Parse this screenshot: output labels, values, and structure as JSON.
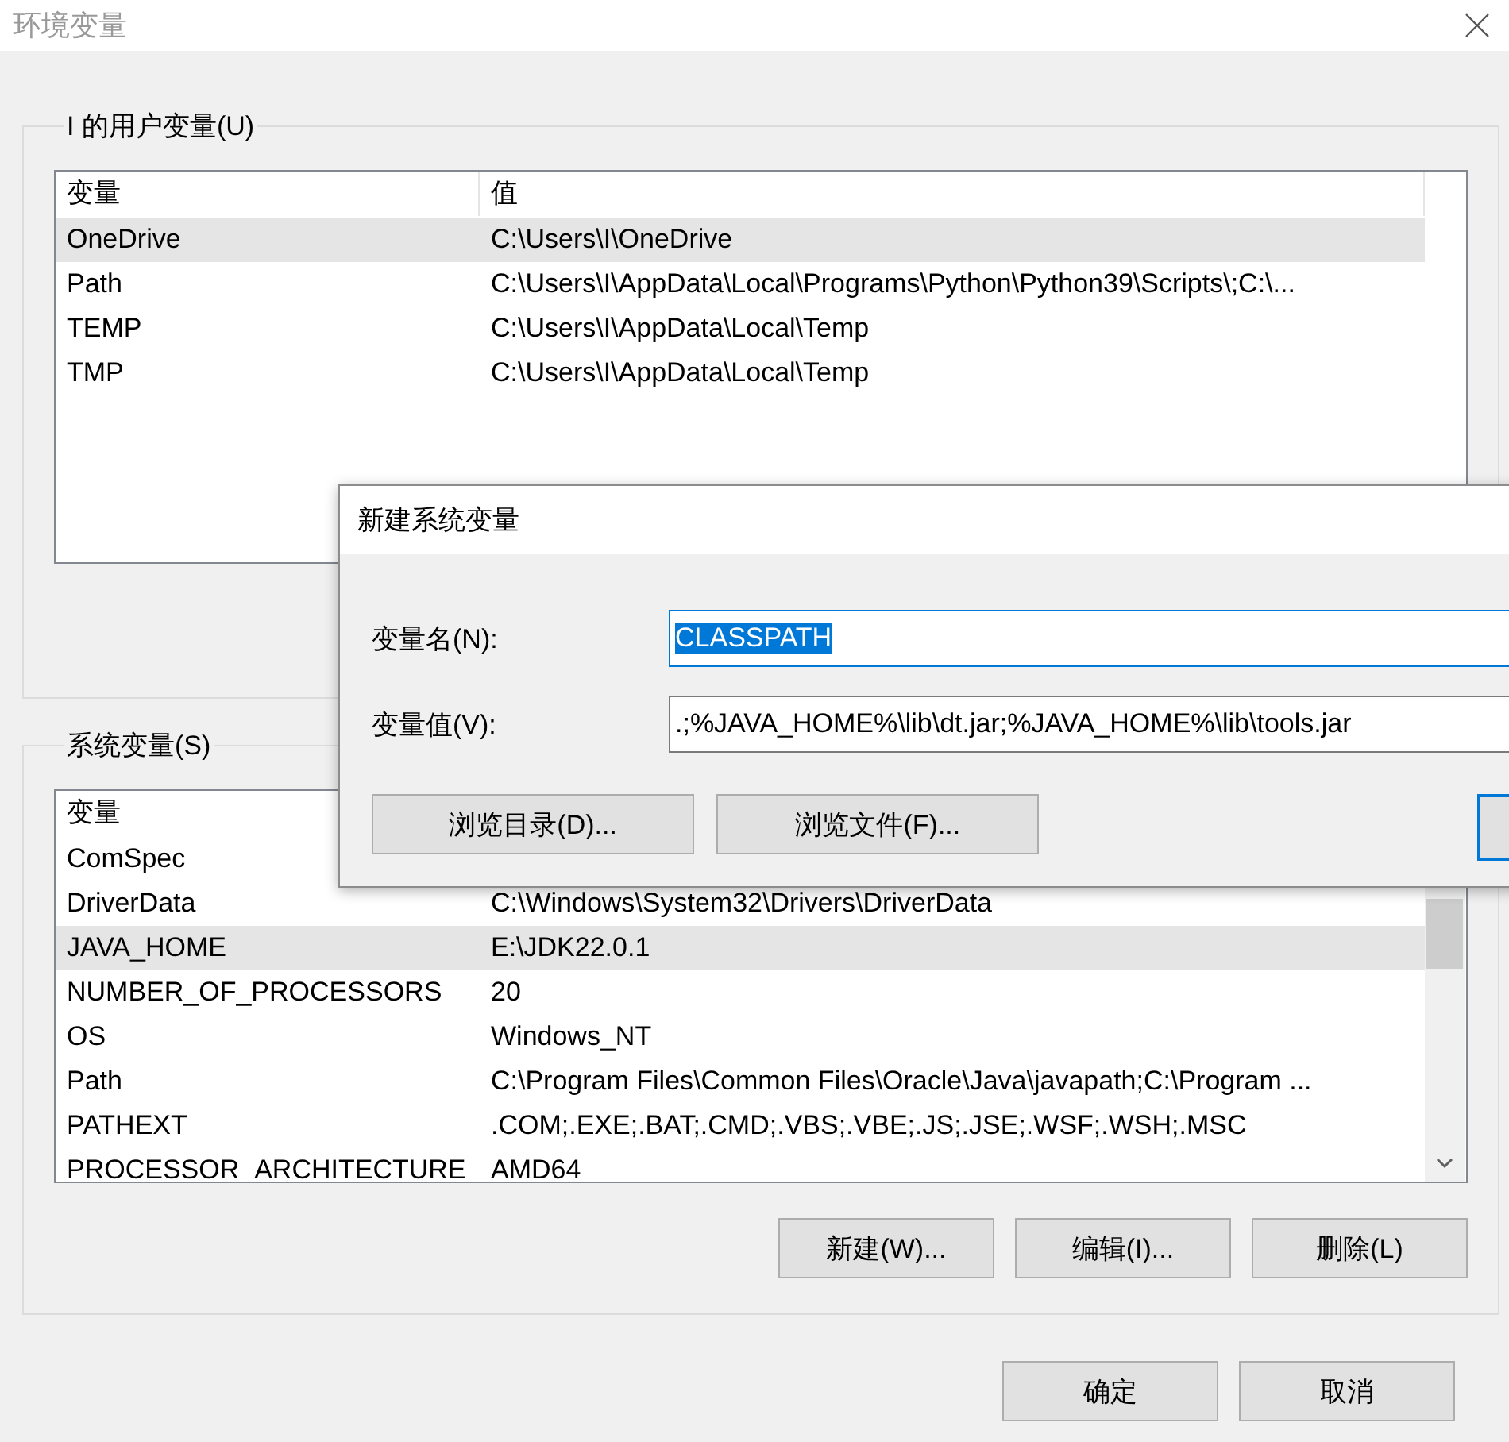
{
  "window": {
    "title": "环境变量"
  },
  "user_variables": {
    "title": "I 的用户变量(U)",
    "columns": [
      "变量",
      "值"
    ],
    "rows": [
      {
        "name": "OneDrive",
        "value": "C:\\Users\\I\\OneDrive",
        "selected": true
      },
      {
        "name": "Path",
        "value": "C:\\Users\\I\\AppData\\Local\\Programs\\Python\\Python39\\Scripts\\;C:\\...",
        "selected": false
      },
      {
        "name": "TEMP",
        "value": "C:\\Users\\I\\AppData\\Local\\Temp",
        "selected": false
      },
      {
        "name": "TMP",
        "value": "C:\\Users\\I\\AppData\\Local\\Temp",
        "selected": false
      }
    ]
  },
  "system_variables": {
    "title": "系统变量(S)",
    "columns": [
      "变量"
    ],
    "rows": [
      {
        "name": "ComSpec",
        "selected": false
      },
      {
        "name": "DriverData",
        "value": "C:\\Windows\\System32\\Drivers\\DriverData",
        "selected": false
      },
      {
        "name": "JAVA_HOME",
        "value": "E:\\JDK22.0.1",
        "selected": true
      },
      {
        "name": "NUMBER_OF_PROCESSORS",
        "value": "20",
        "selected": false
      },
      {
        "name": "OS",
        "value": "Windows_NT",
        "selected": false
      },
      {
        "name": "Path",
        "value": "C:\\Program Files\\Common Files\\Oracle\\Java\\javapath;C:\\Program ...",
        "selected": false
      },
      {
        "name": "PATHEXT",
        "value": ".COM;.EXE;.BAT;.CMD;.VBS;.VBE;.JS;.JSE;.WSF;.WSH;.MSC",
        "selected": false
      },
      {
        "name": "PROCESSOR_ARCHITECTURE",
        "value": "AMD64",
        "selected": false
      }
    ],
    "buttons": [
      "新建(W)...",
      "编辑(I)...",
      "删除(L)"
    ]
  },
  "buttons": [
    "确定",
    "取消"
  ],
  "new_variable_dialog": {
    "title": "新建系统变量",
    "fields": [
      {
        "label": "变量名(N):",
        "value": "CLASSPATH",
        "text_selected": true
      },
      {
        "label": "变量值(V):",
        "value": ".;%JAVA_HOME%\\lib\\dt.jar;%JAVA_HOME%\\lib\\tools.jar",
        "text_selected": false
      }
    ],
    "buttons": [
      "浏览目录(D)...",
      "浏览文件(F)..."
    ]
  }
}
